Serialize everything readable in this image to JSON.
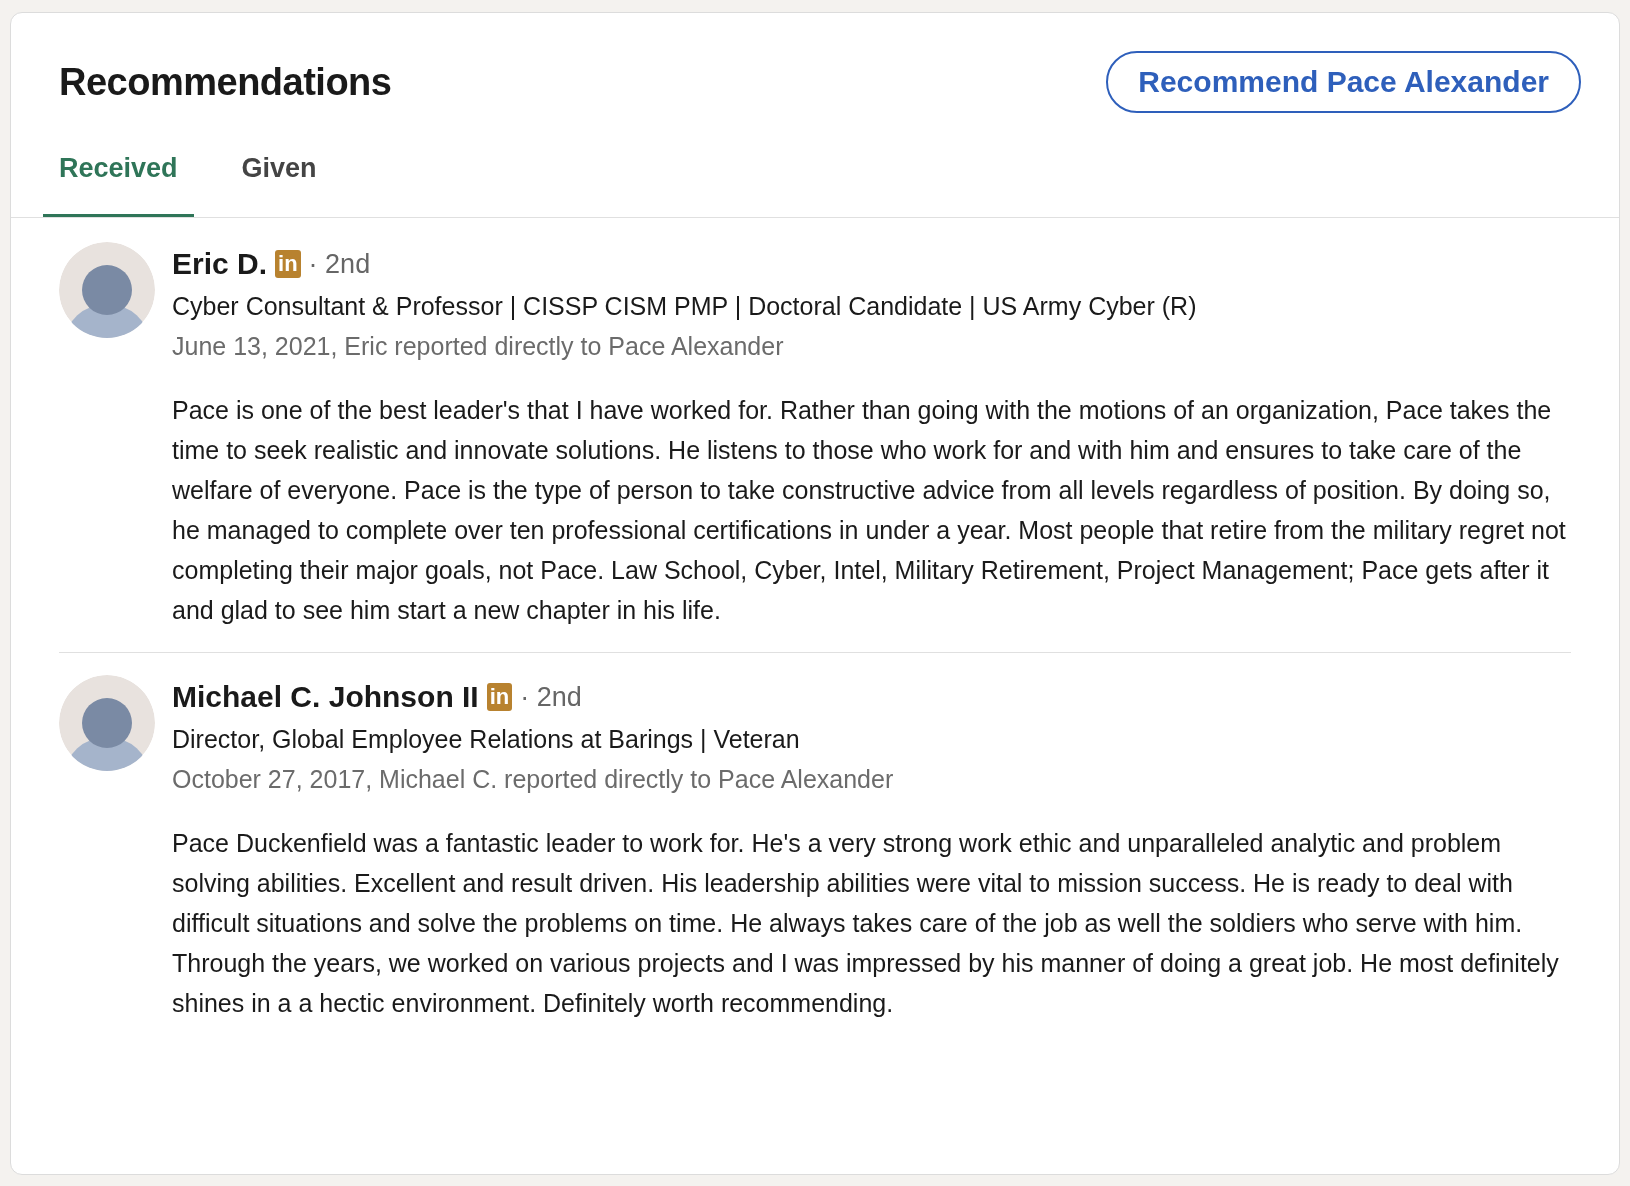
{
  "title": "Recommendations",
  "action_button": "Recommend Pace Alexander",
  "tabs": [
    {
      "label": "Received",
      "selected": true
    },
    {
      "label": "Given",
      "selected": false
    }
  ],
  "recommendations": [
    {
      "name": "Eric D.",
      "badge": "in",
      "degree": "· 2nd",
      "headline": "Cyber Consultant & Professor | CISSP CISM PMP | Doctoral Candidate | US Army Cyber (R)",
      "meta": "June 13, 2021, Eric reported directly to Pace Alexander",
      "text": "Pace is one of the best leader's that I have worked for. Rather than going with the motions of an organization, Pace takes the time to seek realistic and innovate solutions. He listens to those who work for and with him and ensures to take care of the welfare of everyone. Pace is the type of person to take constructive advice from all levels regardless of position. By doing so, he managed to complete over ten professional certifications in under a year. Most people that retire from the military regret not completing their major goals, not Pace. Law School, Cyber, Intel, Military Retirement, Project Management; Pace gets after it and glad to see him start a new chapter in his life."
    },
    {
      "name": "Michael C. Johnson II",
      "badge": "in",
      "degree": "· 2nd",
      "headline": "Director, Global Employee Relations at Barings | Veteran",
      "meta": "October 27, 2017, Michael C. reported directly to Pace Alexander",
      "text": "Pace Duckenfield was a fantastic leader to work for. He's a very strong work ethic and unparalleled analytic and problem solving abilities. Excellent and result driven. His leadership abilities were vital to mission success. He is ready to deal with difficult situations and solve the problems on time. He always takes care of the job as well the soldiers who serve with him. Through the years, we worked on various projects and I was impressed by his manner of doing a great job. He most definitely shines in a a hectic environment. Definitely worth recommending."
    }
  ]
}
